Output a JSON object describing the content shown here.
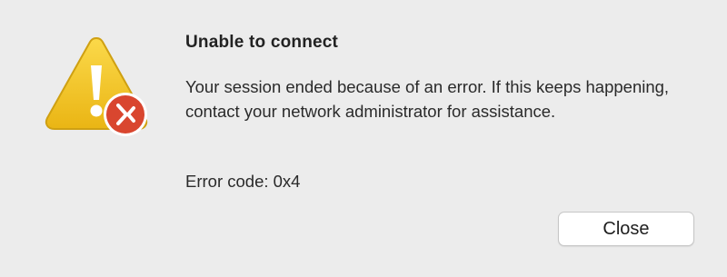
{
  "dialog": {
    "title": "Unable to connect",
    "message": "Your session ended because of an error. If this keeps happening, contact your network administrator for assistance.",
    "error_code": "Error code: 0x4",
    "close_label": "Close",
    "icon": "warning-triangle-icon",
    "badge_icon": "remote-desktop-icon"
  },
  "colors": {
    "background": "#ececec",
    "warning_yellow": "#f2c21b",
    "badge_red": "#d9462f"
  }
}
